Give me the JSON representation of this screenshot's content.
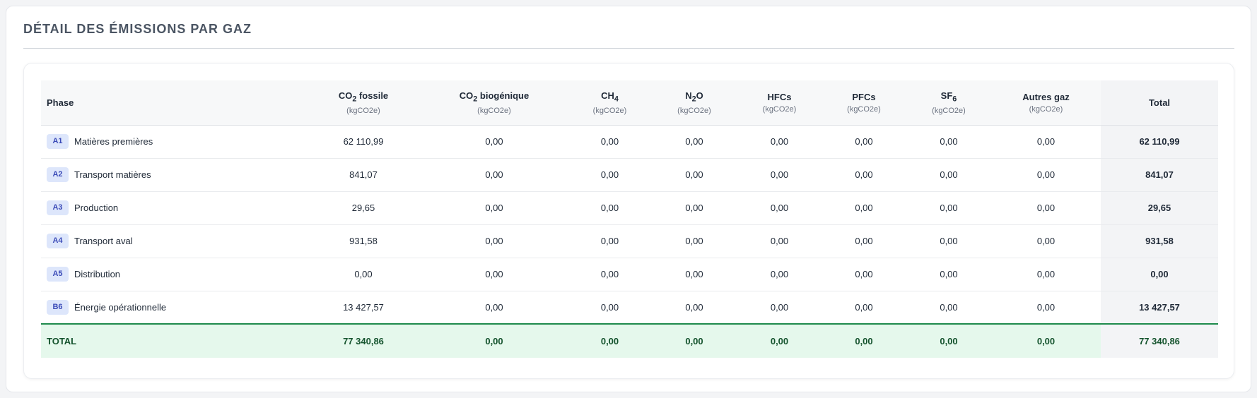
{
  "section": {
    "title": "DÉTAIL DES ÉMISSIONS PAR GAZ"
  },
  "colors": {
    "badge_bg": "#dde6fb",
    "badge_text": "#3b4bb8",
    "total_row_bg": "#e5f8ec",
    "total_row_border": "#1e8a4c",
    "total_text": "#14532d"
  },
  "table": {
    "phase_header": "Phase",
    "total_header": "Total",
    "gas_headers": [
      {
        "base": "CO",
        "sub": "2",
        "suffix": " fossile",
        "unit": "(kgCO2e)"
      },
      {
        "base": "CO",
        "sub": "2",
        "suffix": " biogénique",
        "unit": "(kgCO2e)"
      },
      {
        "base": "CH",
        "sub": "4",
        "suffix": "",
        "unit": "(kgCO2e)"
      },
      {
        "base": "N",
        "sub": "2",
        "suffix": "O",
        "unit": "(kgCO2e)"
      },
      {
        "base": "HFCs",
        "sub": "",
        "suffix": "",
        "unit": "(kgCO2e)"
      },
      {
        "base": "PFCs",
        "sub": "",
        "suffix": "",
        "unit": "(kgCO2e)"
      },
      {
        "base": "SF",
        "sub": "6",
        "suffix": "",
        "unit": "(kgCO2e)"
      },
      {
        "base": "Autres gaz",
        "sub": "",
        "suffix": "",
        "unit": "(kgCO2e)"
      }
    ],
    "rows": [
      {
        "code": "A1",
        "label": "Matières premières",
        "values": [
          "62 110,99",
          "0,00",
          "0,00",
          "0,00",
          "0,00",
          "0,00",
          "0,00",
          "0,00"
        ],
        "total": "62 110,99"
      },
      {
        "code": "A2",
        "label": "Transport matières",
        "values": [
          "841,07",
          "0,00",
          "0,00",
          "0,00",
          "0,00",
          "0,00",
          "0,00",
          "0,00"
        ],
        "total": "841,07"
      },
      {
        "code": "A3",
        "label": "Production",
        "values": [
          "29,65",
          "0,00",
          "0,00",
          "0,00",
          "0,00",
          "0,00",
          "0,00",
          "0,00"
        ],
        "total": "29,65"
      },
      {
        "code": "A4",
        "label": "Transport aval",
        "values": [
          "931,58",
          "0,00",
          "0,00",
          "0,00",
          "0,00",
          "0,00",
          "0,00",
          "0,00"
        ],
        "total": "931,58"
      },
      {
        "code": "A5",
        "label": "Distribution",
        "values": [
          "0,00",
          "0,00",
          "0,00",
          "0,00",
          "0,00",
          "0,00",
          "0,00",
          "0,00"
        ],
        "total": "0,00"
      },
      {
        "code": "B6",
        "label": "Énergie opérationnelle",
        "values": [
          "13 427,57",
          "0,00",
          "0,00",
          "0,00",
          "0,00",
          "0,00",
          "0,00",
          "0,00"
        ],
        "total": "13 427,57"
      }
    ],
    "total_row": {
      "label": "TOTAL",
      "values": [
        "77 340,86",
        "0,00",
        "0,00",
        "0,00",
        "0,00",
        "0,00",
        "0,00",
        "0,00"
      ],
      "total": "77 340,86"
    }
  }
}
